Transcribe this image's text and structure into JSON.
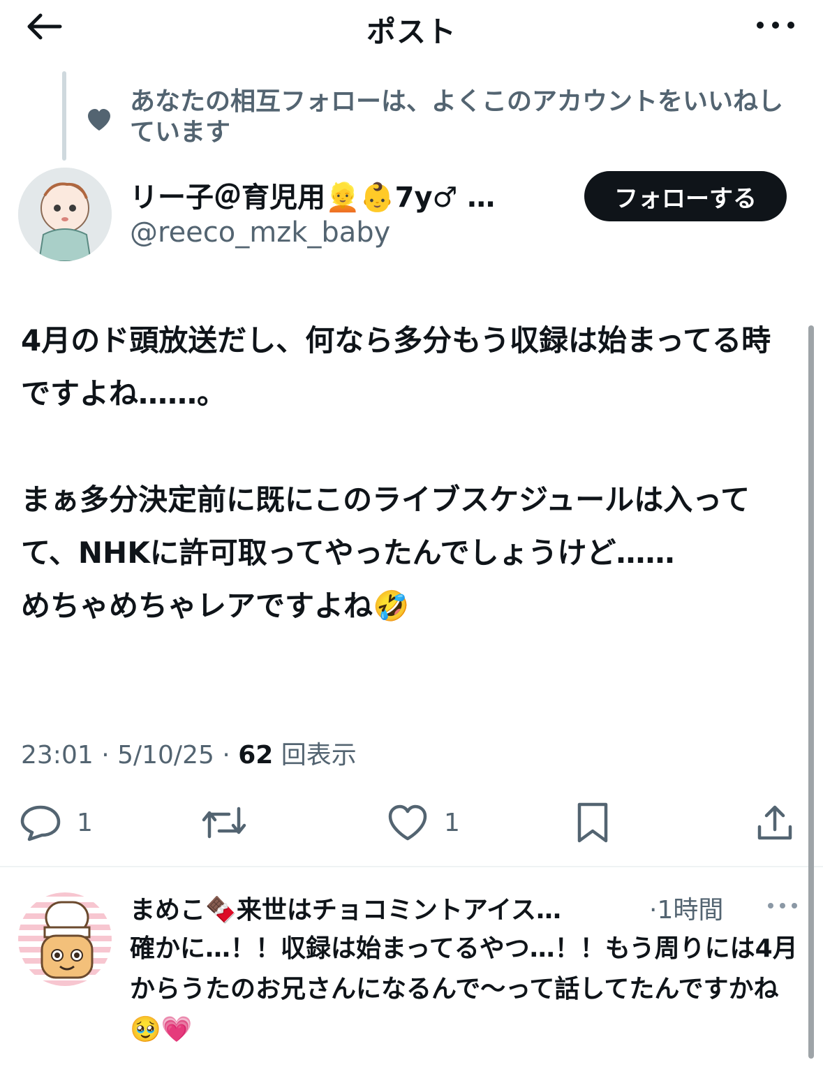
{
  "header": {
    "title": "ポスト",
    "back_icon": "arrow-left-icon",
    "more_icon": "more-horizontal-icon"
  },
  "context": {
    "text": "あなたの相互フォローは、よくこのアカウントをいいねしています",
    "icon": "heart-icon"
  },
  "author": {
    "name": "リー子＠育児用👱👶7y♂ …",
    "handle": "@reeco_mzk_baby",
    "follow_label": "フォローする"
  },
  "post": {
    "text": "4月のド頭放送だし、何なら多分もう収録は始まってる時ですよね……。\n\nまぁ多分決定前に既にこのライブスケジュールは入ってて、NHKに許可取ってやったんでしょうけど……\nめちゃめちゃレアですよね🤣",
    "time": "23:01",
    "date": "5/10/25",
    "views_count": "62",
    "views_label": "回表示"
  },
  "actions": {
    "reply_count": "1",
    "like_count": "1"
  },
  "reply": {
    "name": "まめこ🍫来世はチョコミントアイス…",
    "time": "·1時間",
    "text": "確かに…！！収録は始まってるやつ…！！もう周りには4月からうたのお兄さんになるんで〜って話してたんですかね🥹💗"
  },
  "colors": {
    "text_primary": "#0f1419",
    "text_secondary": "#536471",
    "follow_bg": "#0f1419",
    "divider": "#eff3f4"
  }
}
